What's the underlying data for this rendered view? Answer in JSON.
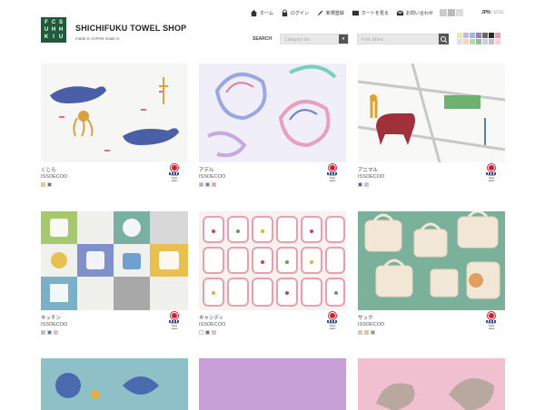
{
  "header": {
    "logo_letters": [
      "F",
      "C",
      "S",
      "U",
      "H",
      "H",
      "K",
      "I",
      "U"
    ],
    "title": "SHICHIFUKU TOWEL SHOP",
    "subtitle": "made in JAPAN made in",
    "nav": [
      {
        "label": "ホーム",
        "icon": "home-icon"
      },
      {
        "label": "ログイン",
        "icon": "lock-icon"
      },
      {
        "label": "新規登録",
        "icon": "pencil-icon"
      },
      {
        "label": "カートを見る",
        "icon": "cart-icon"
      },
      {
        "label": "お問い合わせ",
        "icon": "mail-icon"
      }
    ],
    "lang_active": "JPN",
    "lang_sep": " | ",
    "lang_other": "ENG",
    "search_label": "SEARCH",
    "category_placeholder": "Category list",
    "freeword_placeholder": "Free Word",
    "color_filters": [
      "#f0e6a8",
      "#c8b4e0",
      "#a0b8d8",
      "#9a7fbf",
      "#6a6a6a",
      "#2a2a2a",
      "#e8a0b0",
      "#e0e0e0",
      "#f5d5c0",
      "#b8d8a8",
      "#8fbfa0",
      "#d8c8e8",
      "#c0c0c0",
      "#ffd0d8"
    ]
  },
  "products": [
    {
      "name": "くじら",
      "price": "ISSOECOO",
      "swatches": [
        "#f0d060",
        "#5a70b8"
      ],
      "theme": "whale"
    },
    {
      "name": "アデル",
      "price": "ISSOECOO",
      "swatches": [
        "#b8a8e0",
        "#6a80c8",
        "#e8a0c0"
      ],
      "theme": "paisley"
    },
    {
      "name": "アニマル",
      "price": "ISSOECOO",
      "swatches": [
        "#4a5aa8",
        "#e8b8c8"
      ],
      "theme": "animal"
    },
    {
      "name": "キッチン",
      "price": "ISSOECOO",
      "swatches": [
        "#bbbbbb",
        "#5a70b8",
        "#f0b8c8"
      ],
      "theme": "kitchen"
    },
    {
      "name": "キャンディ",
      "price": "ISSOECOO",
      "swatches": [
        "#ffffff",
        "#5a70b8",
        "#f0b8c8"
      ],
      "theme": "candy"
    },
    {
      "name": "サック",
      "price": "ISSOECOO",
      "swatches": [
        "#f0d060",
        "#e8c0a0",
        "#70b070"
      ],
      "theme": "bag"
    }
  ],
  "mark": {
    "line1": "Imabari Towel",
    "line2": "Japan"
  }
}
